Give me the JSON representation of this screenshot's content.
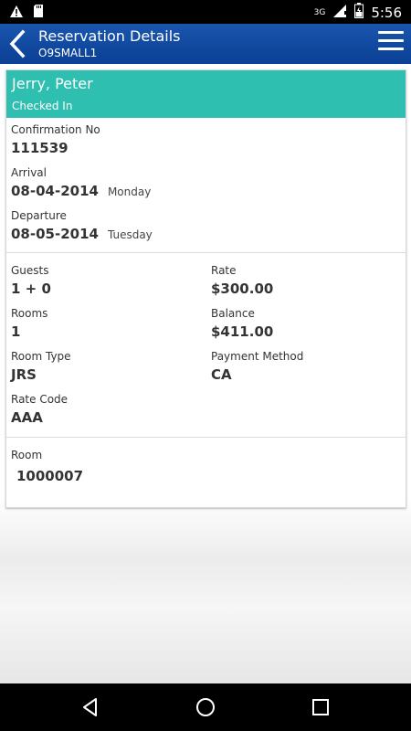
{
  "status_bar": {
    "network": "3G",
    "time": "5:56"
  },
  "app_bar": {
    "title": "Reservation Details",
    "subtitle": "O9SMALL1"
  },
  "guest": {
    "name": "Jerry, Peter",
    "status": "Checked In",
    "header_color": "#2ebfb0"
  },
  "reservation": {
    "confirmation_label": "Confirmation No",
    "confirmation_value": "111539",
    "arrival_label": "Arrival",
    "arrival_date": "08-04-2014",
    "arrival_day": "Monday",
    "departure_label": "Departure",
    "departure_date": "08-05-2014",
    "departure_day": "Tuesday"
  },
  "details": {
    "guests_label": "Guests",
    "guests_value": "1 + 0",
    "rate_label": "Rate",
    "rate_value": "$300.00",
    "rooms_label": "Rooms",
    "rooms_value": "1",
    "balance_label": "Balance",
    "balance_value": "$411.00",
    "room_type_label": "Room Type",
    "room_type_value": "JRS",
    "payment_method_label": "Payment Method",
    "payment_method_value": "CA",
    "rate_code_label": "Rate Code",
    "rate_code_value": "AAA"
  },
  "room": {
    "label": "Room",
    "value": "1000007"
  },
  "colors": {
    "app_bar": "#0b47a0",
    "accent": "#2ebfb0"
  }
}
